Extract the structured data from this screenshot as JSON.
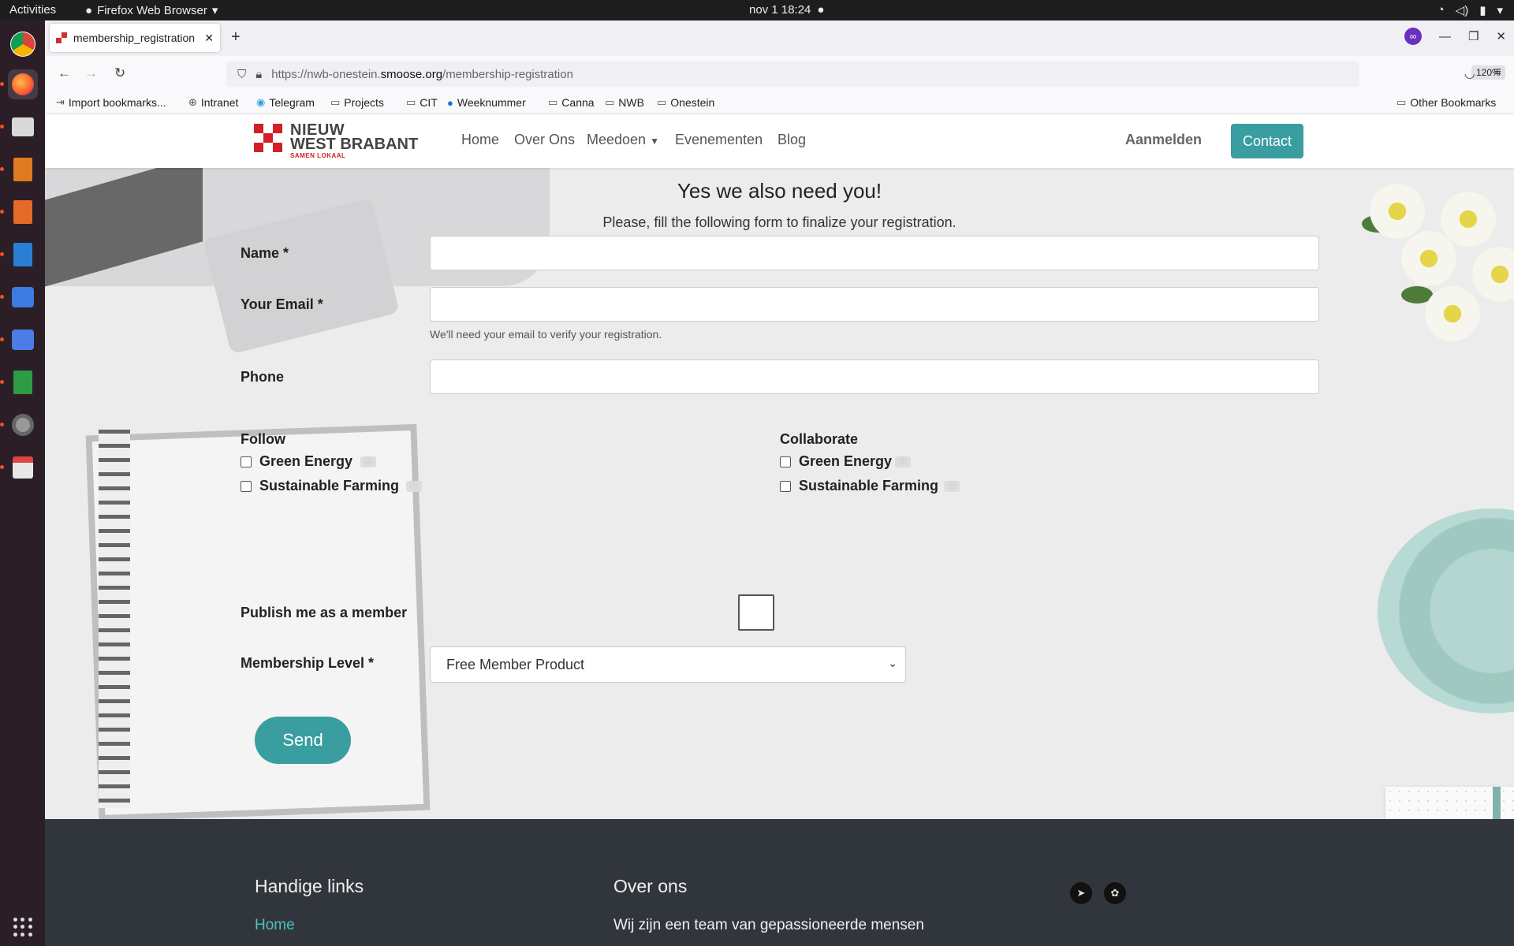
{
  "topbar": {
    "activities": "Activities",
    "app_name": "Firefox Web Browser",
    "clock": "nov 1  18:24"
  },
  "dock": {
    "icons": [
      "chrome-icon",
      "firefox-icon",
      "files-icon",
      "impress-icon",
      "presentation-icon",
      "writer-icon",
      "screenshot-icon",
      "tasks-icon",
      "calc-icon",
      "settings-icon",
      "viewer-icon"
    ]
  },
  "browser": {
    "tab_title": "membership_registration",
    "url_prefix": "https://nwb-onestein.",
    "url_domain": "smoose.org",
    "url_path": "/membership-registration",
    "zoom": "120%",
    "bookmarks": [
      "Import bookmarks...",
      "Intranet",
      "Telegram",
      "Projects",
      "CIT",
      "Weeknummer",
      "Canna",
      "NWB",
      "Onestein"
    ],
    "other_bookmarks": "Other Bookmarks"
  },
  "site": {
    "logo_line1": "NIEUW",
    "logo_line2": "WEST BRABANT",
    "logo_tag": "SAMEN LOKAAL",
    "menu": [
      "Home",
      "Over Ons",
      "Meedoen",
      "Evenementen",
      "Blog"
    ],
    "login": "Aanmelden",
    "contact": "Contact",
    "accent_color": "#3a9ea0"
  },
  "form": {
    "title": "Yes we also need you!",
    "subtitle": "Please, fill the following form to finalize your registration.",
    "name_label": "Name *",
    "email_label": "Your Email *",
    "email_hint": "We'll need your email to verify your registration.",
    "phone_label": "Phone",
    "follow_label": "Follow",
    "collaborate_label": "Collaborate",
    "follow_options": [
      "Green Energy",
      "Sustainable Farming"
    ],
    "collaborate_options": [
      "Green Energy",
      "Sustainable Farming"
    ],
    "publish_label": "Publish me as a member",
    "membership_label": "Membership Level *",
    "membership_value": "Free Member Product",
    "send": "Send"
  },
  "footer": {
    "links_heading": "Handige links",
    "link_home": "Home",
    "about_heading": "Over ons",
    "about_text": "Wij zijn een team van gepassioneerde mensen"
  }
}
